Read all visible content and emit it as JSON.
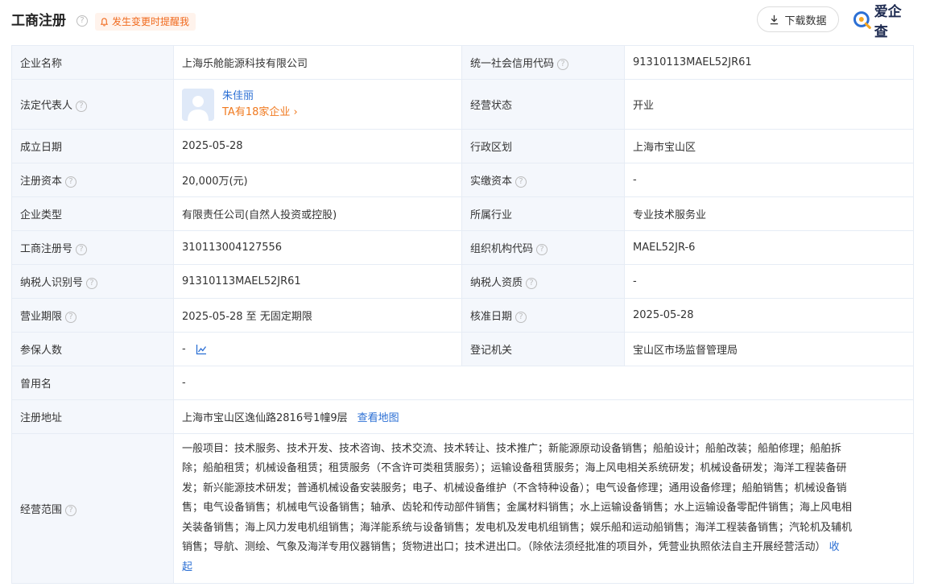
{
  "header": {
    "title": "工商注册",
    "alert_label": "发生变更时提醒我",
    "download_label": "下载数据",
    "brand": "爱企查"
  },
  "rows": {
    "company_name": {
      "k1": "企业名称",
      "v1": "上海乐舱能源科技有限公司",
      "k2": "统一社会信用代码",
      "v2": "91310113MAEL52JR61"
    },
    "legal_rep": {
      "k1": "法定代表人",
      "name": "朱佳丽",
      "sub": "TA有18家企业",
      "k2": "经营状态",
      "v2": "开业"
    },
    "founded": {
      "k1": "成立日期",
      "v1": "2025-05-28",
      "k2": "行政区划",
      "v2": "上海市宝山区"
    },
    "capital": {
      "k1": "注册资本",
      "v1": "20,000万(元)",
      "k2": "实缴资本",
      "v2": "-"
    },
    "type": {
      "k1": "企业类型",
      "v1": "有限责任公司(自然人投资或控股)",
      "k2": "所属行业",
      "v2": "专业技术服务业"
    },
    "reg_no": {
      "k1": "工商注册号",
      "v1": "310113004127556",
      "k2": "组织机构代码",
      "v2": "MAEL52JR-6"
    },
    "tax_id": {
      "k1": "纳税人识别号",
      "v1": "91310113MAEL52JR61",
      "k2": "纳税人资质",
      "v2": "-"
    },
    "term": {
      "k1": "营业期限",
      "v1": "2025-05-28 至 无固定期限",
      "k2": "核准日期",
      "v2": "2025-05-28"
    },
    "insured": {
      "k1": "参保人数",
      "v1": "-",
      "k2": "登记机关",
      "v2": "宝山区市场监督管理局"
    },
    "former_name": {
      "k1": "曾用名",
      "v1": "-"
    },
    "address": {
      "k1": "注册地址",
      "v1": "上海市宝山区逸仙路2816号1幢9层",
      "map_link": "查看地图"
    },
    "scope": {
      "k1": "经营范围",
      "lines": [
        "一般项目：技术服务、技术开发、技术咨询、技术交流、技术转让、技术推广；新能源原动设备销售；船舶设计；船舶改装；船舶修理；船舶拆",
        "除；船舶租赁；机械设备租赁；租赁服务（不含许可类租赁服务）；运输设备租赁服务；海上风电相关系统研发；机械设备研发；海洋工程装备研",
        "发；新兴能源技术研发；普通机械设备安装服务；电子、机械设备维护（不含特种设备）；电气设备修理；通用设备修理；船舶销售；机械设备销",
        "售；电气设备销售；机械电气设备销售；轴承、齿轮和传动部件销售；金属材料销售；水上运输设备销售；水上运输设备零配件销售；海上风电相",
        "关装备销售；海上风力发电机组销售；海洋能系统与设备销售；发电机及发电机组销售；娱乐船和运动船销售；海洋工程装备销售；汽轮机及辅机",
        "销售；导航、测绘、气象及海洋专用仪器销售；货物进出口；技术进出口。（除依法须经批准的项目外，凭营业执照依法自主开展经营活动）"
      ],
      "collapse_a": "收",
      "collapse_b": "起"
    }
  }
}
